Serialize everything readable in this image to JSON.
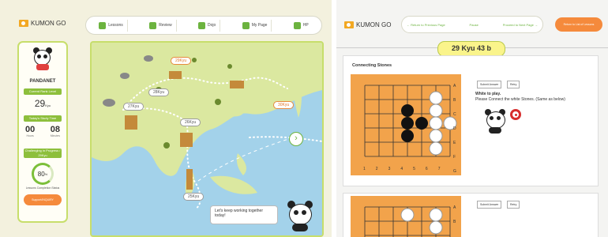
{
  "left": {
    "logo_text": "KUMON GO",
    "nav": [
      {
        "label": "Lessons",
        "icon": "pencil-icon"
      },
      {
        "label": "Review",
        "icon": "review-icon"
      },
      {
        "label": "Dojo",
        "icon": "dojo-icon"
      },
      {
        "label": "My Page",
        "icon": "my-page-icon"
      },
      {
        "label": "HP",
        "icon": "home-icon"
      }
    ],
    "profile": {
      "name": "PANDANET",
      "rank_title": "Current Rank Level",
      "rank_value": "29",
      "rank_unit": "Kyu",
      "study_title": "Today's Study Time",
      "hours": "00",
      "hours_label": "Hours",
      "minutes": "08",
      "minutes_label": "Minutes",
      "challenge_title": "Challenging in Progress / 29Kyu",
      "completion": "80",
      "completion_unit": "%",
      "completion_label": "Lessons Completion Status",
      "support_label": "Support/INQUIRY"
    },
    "map": {
      "labels": [
        "29Kyu",
        "28Kyu",
        "27Kyu",
        "26Kyu",
        "30Kyu",
        "25Kyu"
      ],
      "bubble": "Let's keep working together today!"
    }
  },
  "right": {
    "logo_text": "KUMON GO",
    "nav": {
      "prev": "Return to\nPrevious Page",
      "pause": "Pause",
      "next": "Proceed to\nNext Page"
    },
    "end_label": "Return to\nList of Lessons",
    "grade": "29 Kyu 43 b",
    "problem_title": "Connecting Stones",
    "play_title": "White to play.",
    "play_text": "Please Connect the white Stones. (Same as below)",
    "submit_label": "Submit Answer",
    "retry_label": "Retry",
    "row_labels": [
      "A",
      "B",
      "C",
      "D",
      "E",
      "F",
      "G"
    ],
    "col_labels": [
      "1",
      "2",
      "3",
      "4",
      "5",
      "6",
      "7"
    ],
    "colors": {
      "accent": "#6cb33f",
      "orange": "#f58a3c",
      "board": "#f2a34b"
    }
  }
}
